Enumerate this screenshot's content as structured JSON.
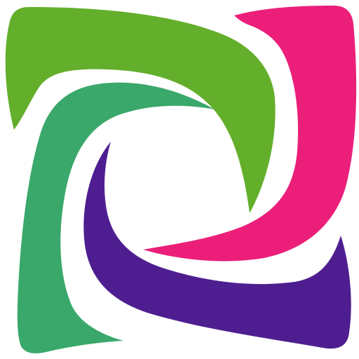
{
  "logo": {
    "icon": "four-swirl-arrows-logo-icon",
    "colors": {
      "green": "#63AF2C",
      "teal": "#39A86A",
      "pink": "#EB1F7A",
      "purple": "#4E1E90",
      "background": "#FFFFFF"
    }
  }
}
